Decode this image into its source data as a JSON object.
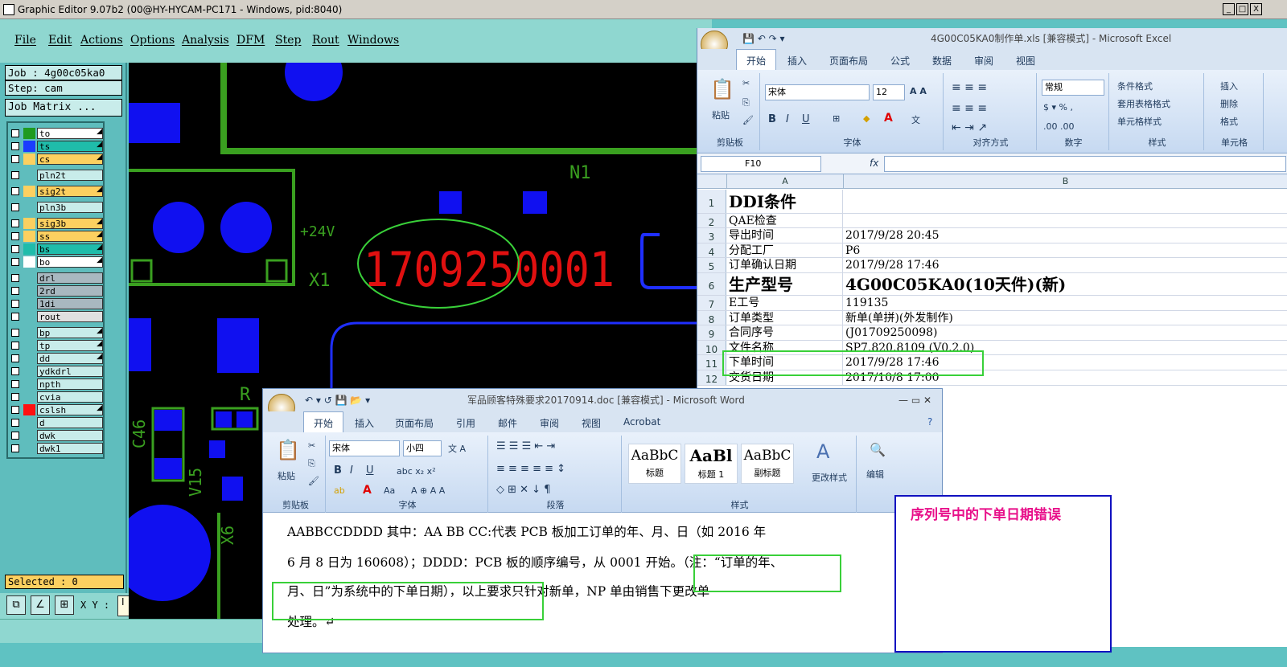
{
  "main_window": {
    "title": "Graphic Editor 9.07b2 (00@HY-HYCAM-PC171 - Windows, pid:8040)",
    "controls": {
      "minimize": "_",
      "restore": "□",
      "close": "X"
    }
  },
  "menu": [
    "File",
    "Edit",
    "Actions",
    "Options",
    "Analysis",
    "DFM",
    "Step",
    "Rout",
    "Windows"
  ],
  "panel": {
    "job": "Job : 4g00c05ka0",
    "step": "Step: cam",
    "job_matrix": "Job Matrix ...",
    "selected": "Selected : 0",
    "xy_label": "X Y :",
    "xy_value": "I"
  },
  "layers": [
    {
      "name": "to",
      "swatch": "#1f9a1f",
      "bg": "#ffffff",
      "arrow": true
    },
    {
      "name": "ts",
      "swatch": "#1a3cff",
      "bg": "#1fbcaa",
      "arrow": true
    },
    {
      "name": "cs",
      "swatch": "#fcd060",
      "bg": "#fcd060",
      "arrow": true
    },
    {
      "name": "pln2t",
      "swatch": "#5fbdbd",
      "bg": "#c8ecea",
      "arrow": false
    },
    {
      "name": "sig2t",
      "swatch": "#fcd060",
      "bg": "#fcd060",
      "arrow": true
    },
    {
      "name": "pln3b",
      "swatch": "#5fbdbd",
      "bg": "#c8ecea",
      "arrow": false
    },
    {
      "name": "sig3b",
      "swatch": "#fcd060",
      "bg": "#fcd060",
      "arrow": true
    },
    {
      "name": "ss",
      "swatch": "#fcd060",
      "bg": "#fcd060",
      "arrow": true
    },
    {
      "name": "bs",
      "swatch": "#1fbcaa",
      "bg": "#1fbcaa",
      "arrow": true
    },
    {
      "name": "bo",
      "swatch": "#ffffff",
      "bg": "#ffffff",
      "arrow": true
    },
    {
      "name": "drl",
      "swatch": "#5fbdbd",
      "bg": "#a8b8c0",
      "arrow": false
    },
    {
      "name": "2rd",
      "swatch": "#5fbdbd",
      "bg": "#a8b8c0",
      "arrow": false
    },
    {
      "name": "1di",
      "swatch": "#5fbdbd",
      "bg": "#a8b8c0",
      "arrow": false
    },
    {
      "name": "rout",
      "swatch": "#5fbdbd",
      "bg": "#e0e0e0",
      "arrow": false
    },
    {
      "name": "bp",
      "swatch": "#5fbdbd",
      "bg": "#c8ecea",
      "arrow": true
    },
    {
      "name": "tp",
      "swatch": "#5fbdbd",
      "bg": "#c8ecea",
      "arrow": true
    },
    {
      "name": "dd",
      "swatch": "#5fbdbd",
      "bg": "#c8ecea",
      "arrow": true
    },
    {
      "name": "ydkdrl",
      "swatch": "#5fbdbd",
      "bg": "#c8ecea",
      "arrow": false
    },
    {
      "name": "npth",
      "swatch": "#5fbdbd",
      "bg": "#c8ecea",
      "arrow": false
    },
    {
      "name": "cvia",
      "swatch": "#5fbdbd",
      "bg": "#c8ecea",
      "arrow": false
    },
    {
      "name": "cslsh",
      "swatch": "#ff1010",
      "bg": "#c8ecea",
      "arrow": true
    },
    {
      "name": "d",
      "swatch": "#5fbdbd",
      "bg": "#c8ecea",
      "arrow": false
    },
    {
      "name": "dwk",
      "swatch": "#5fbdbd",
      "bg": "#c8ecea",
      "arrow": false
    },
    {
      "name": "dwk1",
      "swatch": "#5fbdbd",
      "bg": "#c8ecea",
      "arrow": false
    }
  ],
  "canvas": {
    "serial": "1709250001",
    "labels": {
      "n1": "N1",
      "plus24v": "+24V",
      "x1": "X1",
      "c46": "C46",
      "v15": "V15",
      "x6": "X6",
      "r": "R"
    }
  },
  "excel": {
    "title": "4G00C05KA0制作单.xls [兼容模式] - Microsoft Excel",
    "tabs": [
      "开始",
      "插入",
      "页面布局",
      "公式",
      "数据",
      "审阅",
      "视图"
    ],
    "font": "宋体",
    "size": "12",
    "number_format": "常规",
    "groups": [
      "剪贴板",
      "字体",
      "对齐方式",
      "数字",
      "样式",
      "单元格"
    ],
    "buttons": {
      "paste": "粘贴",
      "cond_format": "条件格式",
      "table_format": "套用表格格式",
      "cell_style": "单元格样式",
      "insert": "插入",
      "delete": "删除",
      "format": "格式"
    },
    "name_box": "F10",
    "fx": "fx",
    "columns": [
      "A",
      "B"
    ],
    "rows": [
      {
        "n": "1",
        "a": "DDI条件",
        "b": ""
      },
      {
        "n": "2",
        "a": "QAE检查",
        "b": ""
      },
      {
        "n": "3",
        "a": "导出时间",
        "b": "2017/9/28 20:45"
      },
      {
        "n": "4",
        "a": "分配工厂",
        "b": "P6"
      },
      {
        "n": "5",
        "a": "订单确认日期",
        "b": "2017/9/28 17:46"
      },
      {
        "n": "6",
        "a": "生产型号",
        "b": "4G00C05KA0(10天件)(新)"
      },
      {
        "n": "7",
        "a": "E工号",
        "b": "119135"
      },
      {
        "n": "8",
        "a": "订单类型",
        "b": "新单(单拼)(外发制作)"
      },
      {
        "n": "9",
        "a": "合同序号",
        "b": "(J01709250098)"
      },
      {
        "n": "10",
        "a": "文件名称",
        "b": "SP7.820.8109 (V0.2.0)"
      },
      {
        "n": "11",
        "a": "下单时间",
        "b": "2017/9/28 17:46"
      },
      {
        "n": "12",
        "a": "交货日期",
        "b": "2017/10/8 17:00"
      }
    ]
  },
  "word": {
    "title": "军品顾客特殊要求20170914.doc [兼容模式] - Microsoft Word",
    "tabs": [
      "开始",
      "插入",
      "页面布局",
      "引用",
      "邮件",
      "审阅",
      "视图",
      "Acrobat"
    ],
    "font": "宋体",
    "size": "小四",
    "groups": [
      "剪贴板",
      "字体",
      "段落",
      "样式"
    ],
    "styles": [
      {
        "preview": "AaBbC",
        "name": "标题"
      },
      {
        "preview": "AaBl",
        "name": "标题 1"
      },
      {
        "preview": "AaBbC",
        "name": "副标题"
      }
    ],
    "buttons": {
      "paste": "粘贴",
      "change_style": "更改样式",
      "edit": "编辑"
    },
    "lines": [
      "AABBCCDDDD  其中：AA BB  CC:代表 PCB 板加工订单的年、月、日（如 2016 年",
      "6 月 8 日为 160608）；DDDD：PCB 板的顺序编号，从 0001 开始。（注：“订单的年、",
      "月、日”为系统中的下单日期），以上要求只针对新单，NP 单由销售下更改单",
      "处理。↵"
    ]
  },
  "callout": "序列号中的下单日期错误",
  "colors": {
    "highlight_green": "#39d039",
    "serial_red": "#e01010",
    "callout_pink": "#e8108a",
    "callout_border": "#1010c0"
  }
}
